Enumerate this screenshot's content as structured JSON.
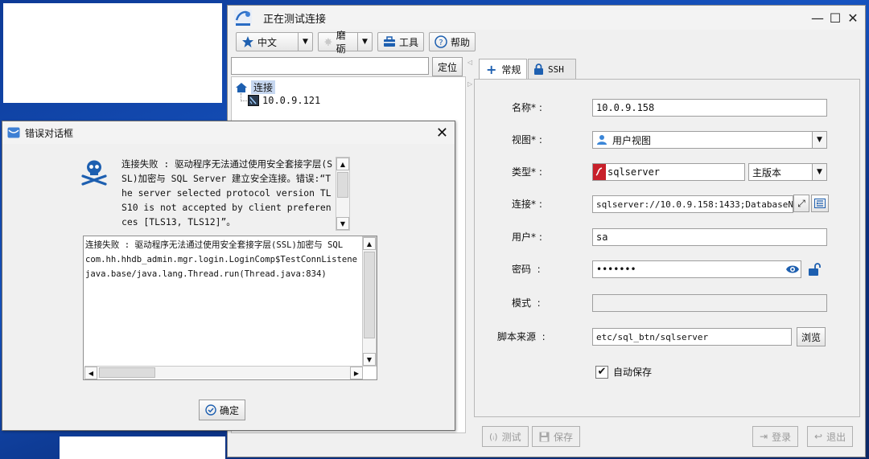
{
  "window": {
    "title": "正在测试连接",
    "controls": {
      "minimize": "—",
      "maximize": "☐",
      "close": "✕"
    }
  },
  "toolbar": {
    "language": "中文",
    "theme": "磨砺",
    "tools": "工具",
    "help": "帮助"
  },
  "locator": {
    "value": "",
    "button": "定位"
  },
  "tree": {
    "root": "连接",
    "child": "10.0.9.121"
  },
  "tabs": {
    "general": "常规",
    "ssh": "SSH"
  },
  "form": {
    "name_label": "名称",
    "name_value": "10.0.9.158",
    "view_label": "视图",
    "view_value": "用户视图",
    "type_label": "类型",
    "type_value": "sqlserver",
    "version_value": "主版本",
    "conn_label": "连接",
    "conn_value": "sqlserver://10.0.9.158:1433;DatabaseN",
    "user_label": "用户",
    "user_value": "sa",
    "password_label": "密码",
    "password_value": "•••••••",
    "schema_label": "模式",
    "schema_value": "",
    "script_label": "脚本来源",
    "script_value": "etc/sql_btn/sqlserver",
    "browse": "浏览",
    "autosave": "自动保存",
    "required_mark": "*",
    "colon": ":"
  },
  "bottom": {
    "test": "测试",
    "save": "保存",
    "login": "登录",
    "exit": "退出"
  },
  "error_dialog": {
    "title": "错误对话框",
    "summary": "连接失败 : 驱动程序无法通过使用安全套接字层(SSL)加密与 SQL Server 建立安全连接。错误:“The server selected protocol version TLS10 is not accepted by client preferences [TLS13, TLS12]”。",
    "detail_lines": [
      "连接失败 : 驱动程序无法通过使用安全套接字层(SSL)加密与 SQL",
      "com.hh.hhdb_admin.mgr.login.LoginComp$TestConnListene",
      "java.base/java.lang.Thread.run(Thread.java:834)"
    ],
    "ok": "确定"
  },
  "colors": {
    "accent": "#1d5fb0",
    "desktop": "#1653c0",
    "tree_highlight": "#c6d7f0"
  }
}
